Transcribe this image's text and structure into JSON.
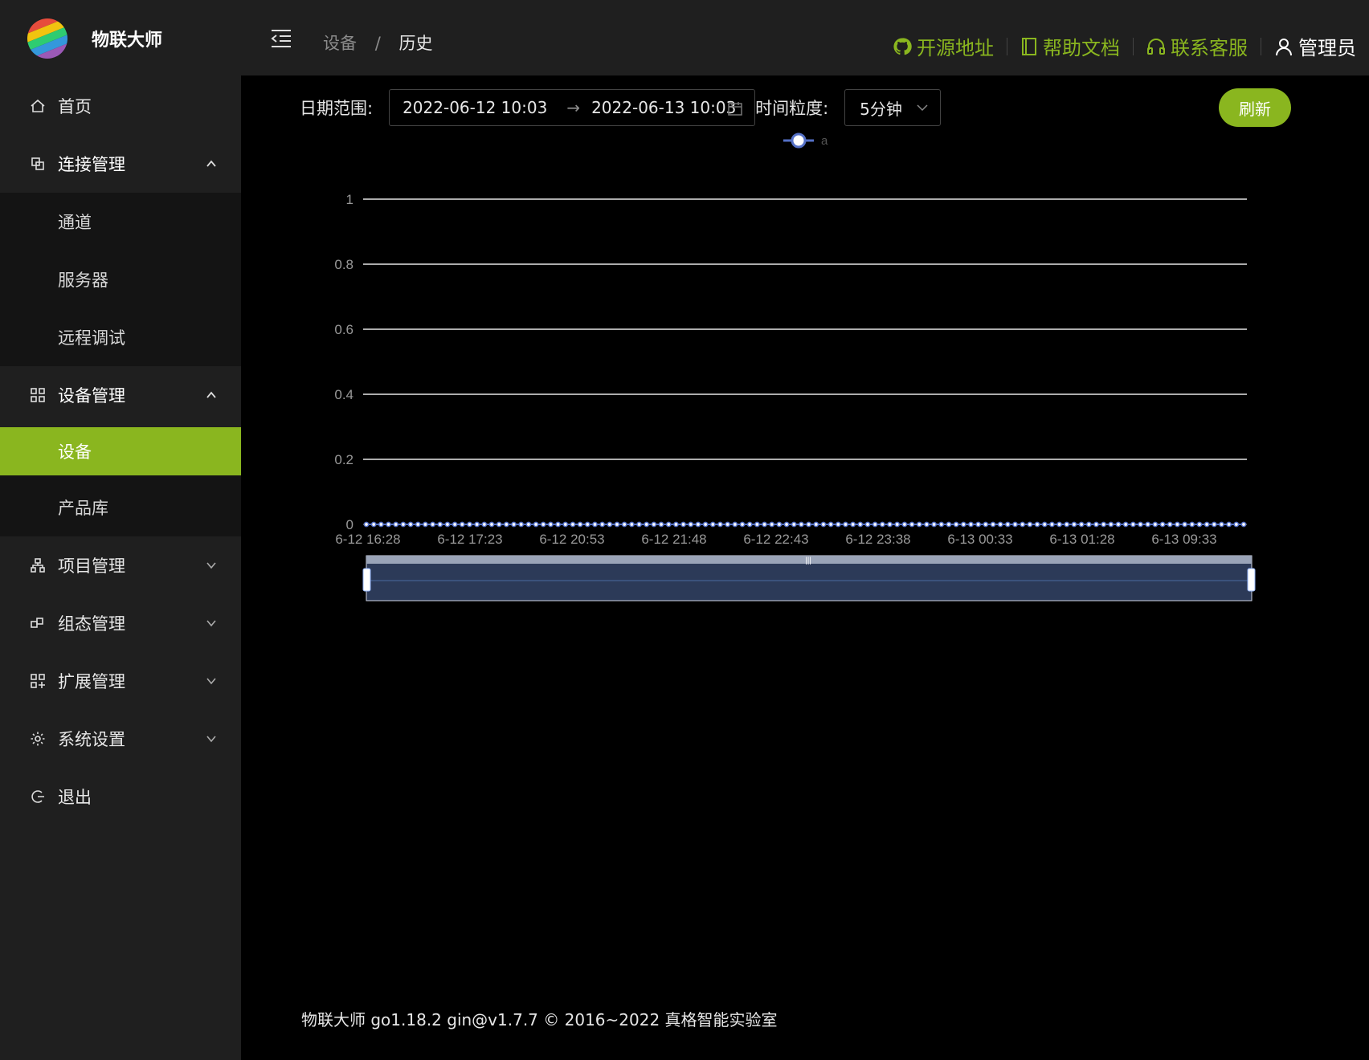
{
  "app": {
    "title": "物联大师",
    "logo_colors": [
      "#e74c3c",
      "#f39c12",
      "#f1c40f",
      "#2ecc71",
      "#3498db",
      "#9b59b6"
    ]
  },
  "sidebar": {
    "items": [
      {
        "label": "首页",
        "icon": "home-icon"
      },
      {
        "label": "连接管理",
        "icon": "link-icon",
        "expanded": true,
        "children": [
          {
            "label": "通道"
          },
          {
            "label": "服务器"
          },
          {
            "label": "远程调试"
          }
        ]
      },
      {
        "label": "设备管理",
        "icon": "grid-icon",
        "expanded": true,
        "children": [
          {
            "label": "设备",
            "active": true
          },
          {
            "label": "产品库"
          }
        ]
      },
      {
        "label": "项目管理",
        "icon": "project-icon",
        "expanded": false
      },
      {
        "label": "组态管理",
        "icon": "component-icon",
        "expanded": false
      },
      {
        "label": "扩展管理",
        "icon": "extension-icon",
        "expanded": false
      },
      {
        "label": "系统设置",
        "icon": "gear-icon",
        "expanded": false
      },
      {
        "label": "退出",
        "icon": "logout-icon"
      }
    ],
    "accent": "#8ab61f"
  },
  "header": {
    "breadcrumb": [
      "设备",
      "历史"
    ],
    "links": [
      {
        "label": "开源地址",
        "icon": "github-icon"
      },
      {
        "label": "帮助文档",
        "icon": "book-icon"
      },
      {
        "label": "联系客服",
        "icon": "headset-icon"
      }
    ],
    "user": "管理员"
  },
  "toolbar": {
    "date_label": "日期范围:",
    "start": "2022-06-12 10:03",
    "end": "2022-06-13 10:03",
    "arrow": "→",
    "granularity_label": "时间粒度:",
    "granularity": "5分钟",
    "refresh": "刷新"
  },
  "chart_data": {
    "type": "line",
    "legend": [
      "a"
    ],
    "legend_position": "top-center",
    "ylim": [
      0,
      1
    ],
    "yticks": [
      "0",
      "0.2",
      "0.4",
      "0.6",
      "0.8",
      "1"
    ],
    "xtick_labels": [
      "6-12 16:28",
      "6-12 17:23",
      "6-12 20:53",
      "6-12 21:48",
      "6-12 22:43",
      "6-12 23:38",
      "6-13 00:33",
      "6-13 01:28",
      "6-13 09:33"
    ],
    "series": [
      {
        "name": "a",
        "point_count": 120,
        "value": 0,
        "color": "#5470c6"
      }
    ],
    "data_zoom": [
      0,
      100
    ],
    "grid": true
  },
  "footer": {
    "text": "物联大师 go1.18.2 gin@v1.7.7 © 2016~2022 真格智能实验室"
  }
}
